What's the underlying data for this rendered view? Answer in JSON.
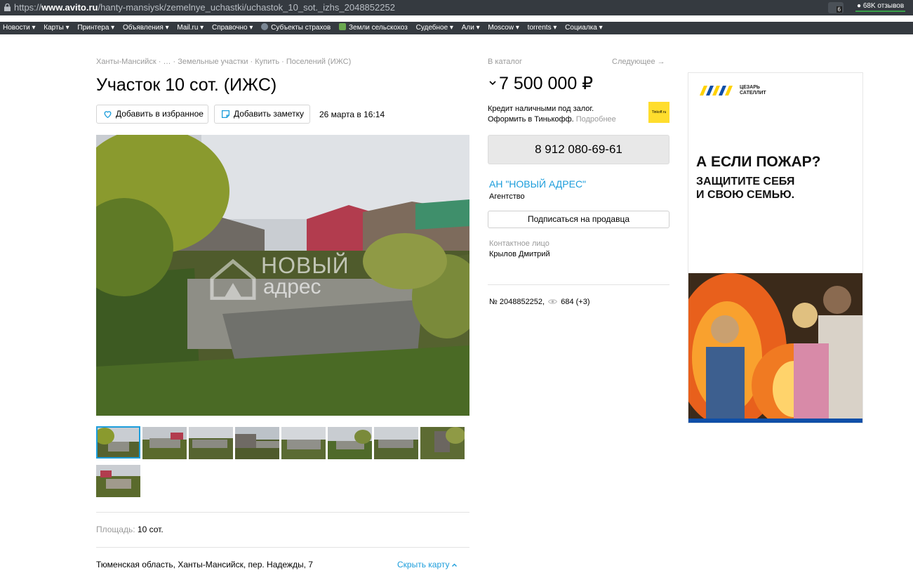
{
  "browser": {
    "url_prefix": "https://",
    "url_domain": "www.avito.ru",
    "url_path": "/hanty-mansiysk/zemelnye_uchastki/uchastok_10_sot._izhs_2048852252",
    "ext_badge": "6",
    "reviews_badge": "68K отзывов"
  },
  "bookmarks": [
    "Новости ▾",
    "Карты ▾",
    "Принтера ▾",
    "Объявления ▾",
    "Mail.ru ▾",
    "Справочно ▾",
    "Субъекты страхов",
    "Земли сельскохоз",
    "Судебное ▾",
    "Али ▾",
    "Moscow ▾",
    "torrents ▾",
    "Социалка ▾"
  ],
  "listing": {
    "breadcrumbs": "Ханты-Мансийск · … · Земельные участки · Купить · Поселений (ИЖС)",
    "title": "Участок 10 сот. (ИЖС)",
    "favorite_label": "Добавить в избранное",
    "note_label": "Добавить заметку",
    "date": "26 марта в 16:14",
    "photo_watermark_1": "НОВЫЙ",
    "photo_watermark_2": "адрес",
    "area_label": "Площадь:",
    "area_value": "10 сот.",
    "address": "Тюменская область, Ханты-Мансийск, пер. Надежды, 7",
    "hide_map_label": "Скрыть карту"
  },
  "sidebar": {
    "catalog_link": "В каталог",
    "next_link": "Следующее →",
    "price": "7 500 000 ₽",
    "credit_line1": "Кредит наличными под залог.",
    "credit_line2": "Оформить в Тинькофф.",
    "credit_more": "Подробнее",
    "bank_logo_text": "Tinkoff.ru",
    "phone": "8 912 080-69-61",
    "seller_name": "АН \"НОВЫЙ АДРЕС\"",
    "seller_type": "Агентство",
    "subscribe_label": "Подписаться на продавца",
    "contact_label": "Контактное лицо",
    "contact_name": "Крылов Дмитрий",
    "item_number": "№ 2048852252,",
    "views": "684 (+3)"
  },
  "ad": {
    "brand_line1": "ЦЕЗАРЬ",
    "brand_line2": "САТЕЛЛИТ",
    "headline": "А ЕСЛИ ПОЖАР?",
    "subline1": "ЗАЩИТИТЕ СЕБЯ",
    "subline2": "И СВОЮ СЕМЬЮ."
  },
  "colors": {
    "link": "#1c9ddb",
    "browser_bar": "#353a40",
    "phone_button": "#e8e8e8",
    "tinkoff": "#ffdd2d",
    "ad_blue": "#0f4fa8",
    "ad_yellow": "#ffd200"
  }
}
